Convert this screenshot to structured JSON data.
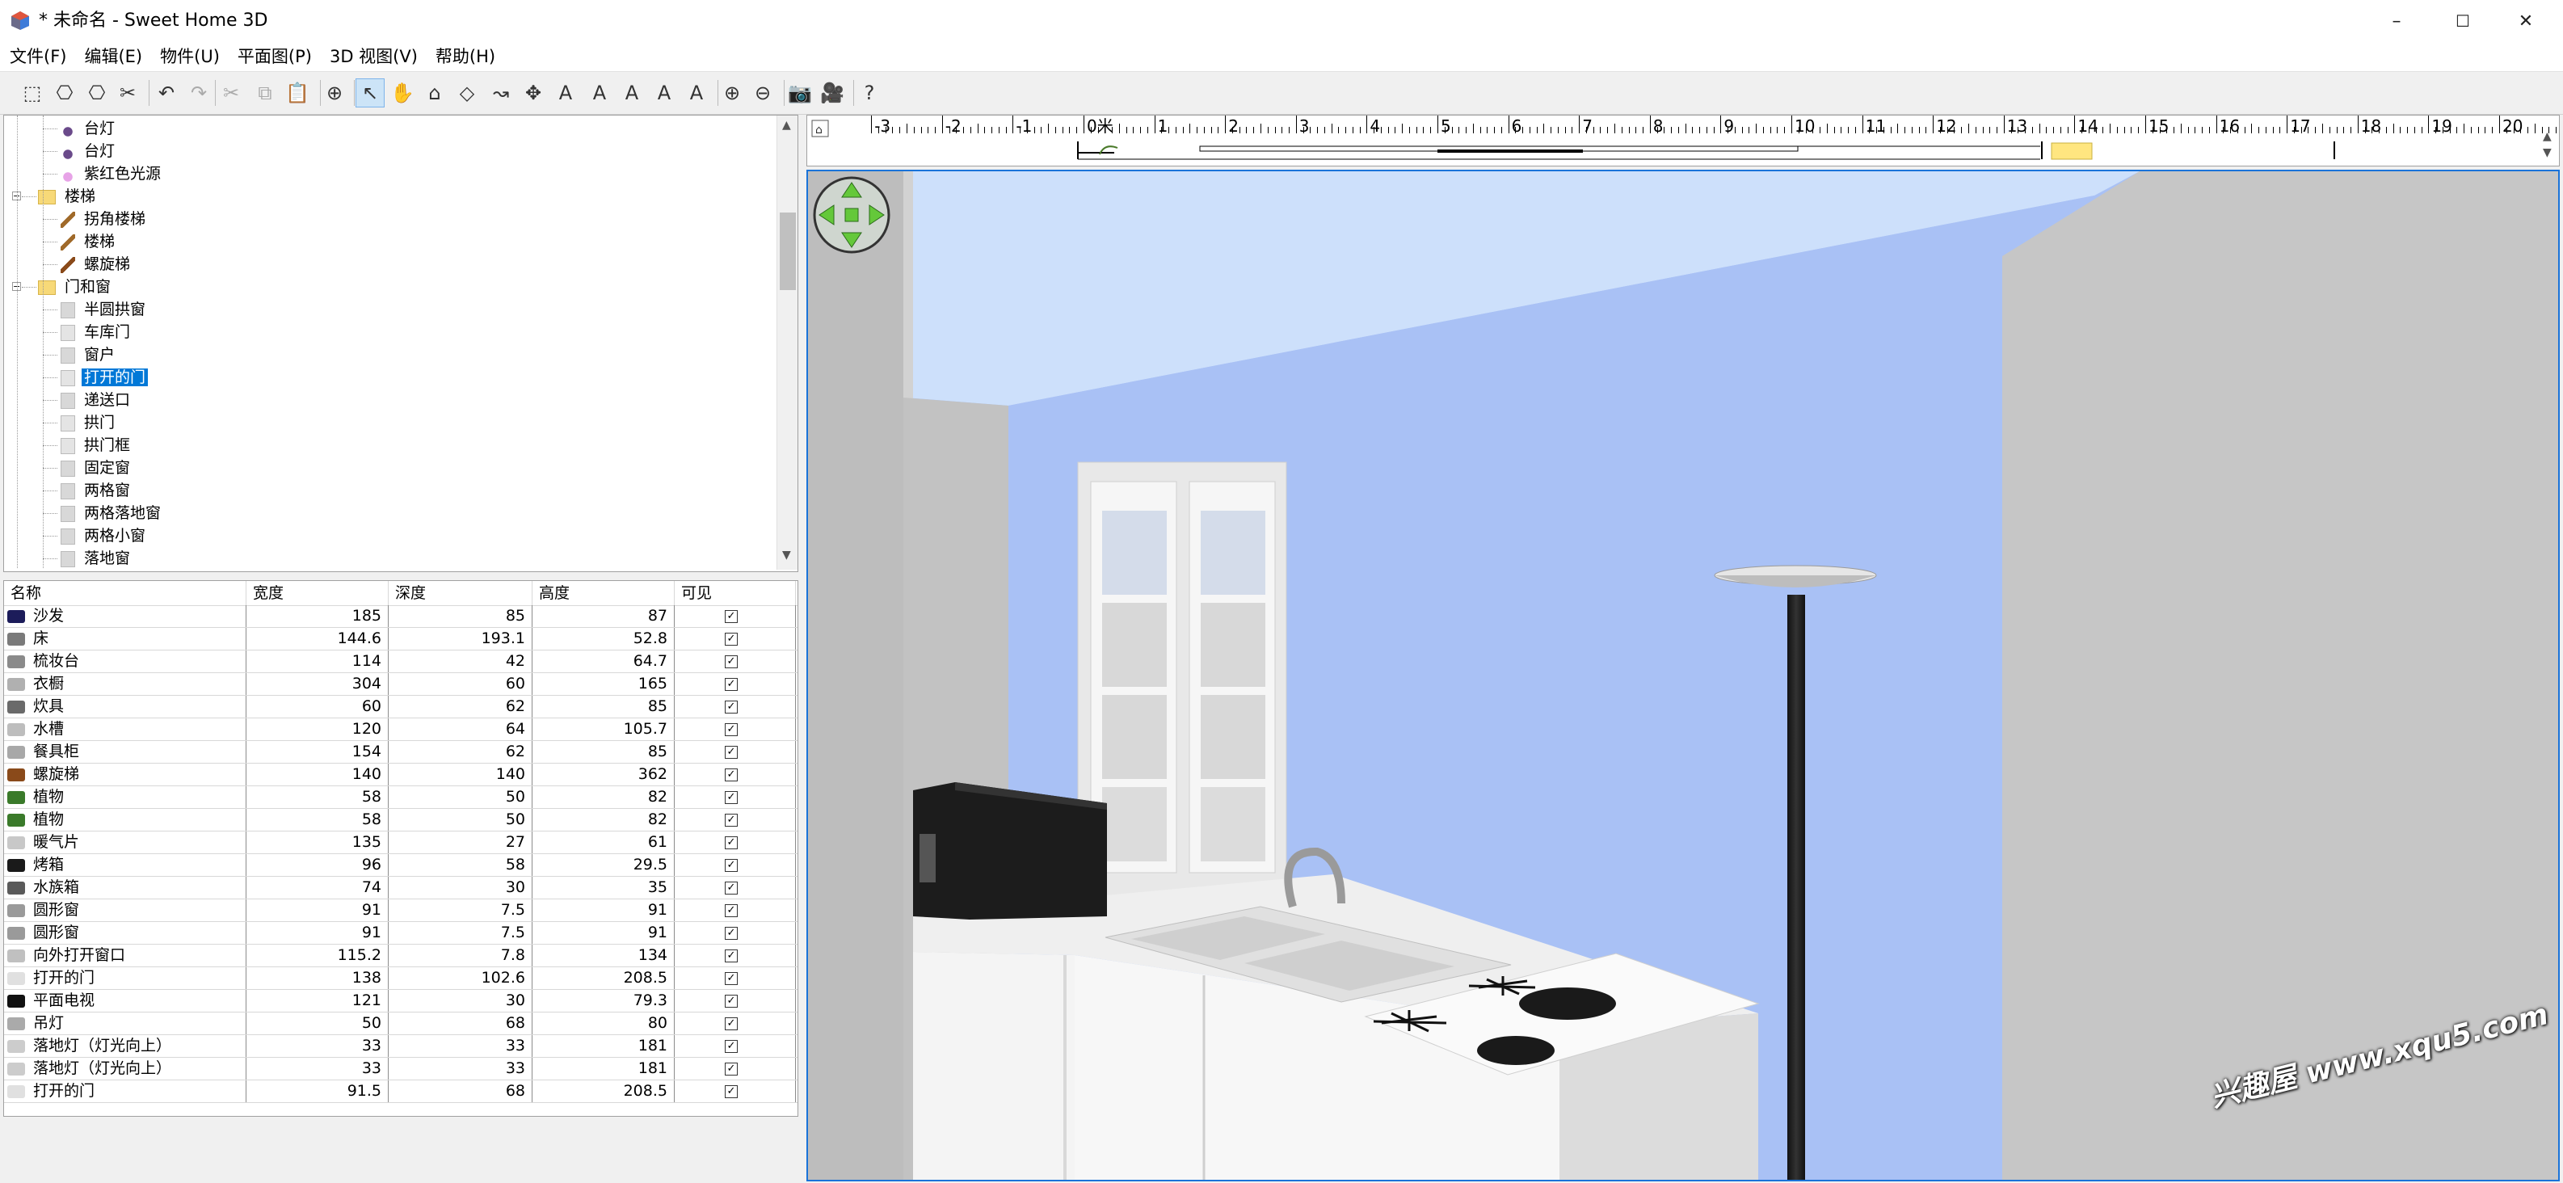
{
  "window": {
    "title": "* 未命名 - Sweet Home 3D",
    "minimize": "–",
    "maximize": "☐",
    "close": "✕"
  },
  "menu": [
    "文件(F)",
    "编辑(E)",
    "物件(U)",
    "平面图(P)",
    "3D 视图(V)",
    "帮助(H)"
  ],
  "toolbar": {
    "icons": [
      "new-home-icon",
      "open-icon",
      "save-icon",
      "cut-tool-icon",
      "undo-icon",
      "redo-icon",
      "cut-icon",
      "copy-icon",
      "paste-icon",
      "add-furniture-icon",
      "select-icon",
      "pan-icon",
      "create-walls-icon",
      "create-rooms-icon",
      "create-polylines-icon",
      "create-dimensions-icon",
      "add-text-icon",
      "increase-text-icon",
      "decrease-text-icon",
      "bold-icon",
      "italic-icon",
      "zoom-in-icon",
      "zoom-out-icon",
      "photo-icon",
      "video-icon",
      "help-icon"
    ],
    "glyphs": [
      "⬚",
      "⎔",
      "⎔",
      "✂",
      "↶",
      "↷",
      "✂",
      "⧉",
      "📋",
      "⊕",
      "↖",
      "✋",
      "⌂",
      "◇",
      "↝",
      "✥",
      "A",
      "A",
      "A",
      "A",
      "A",
      "⊕",
      "⊖",
      "📷",
      "🎥",
      "?"
    ],
    "selected": "select-icon"
  },
  "tree": {
    "items": [
      {
        "label": "台灯",
        "level": 2,
        "icon": "lamp-icon"
      },
      {
        "label": "台灯",
        "level": 2,
        "icon": "lamp-icon"
      },
      {
        "label": "紫红色光源",
        "level": 2,
        "icon": "light-source-icon"
      },
      {
        "label": "楼梯",
        "level": 1,
        "icon": "folder-icon",
        "expanded": true
      },
      {
        "label": "拐角楼梯",
        "level": 2,
        "icon": "stair-icon"
      },
      {
        "label": "楼梯",
        "level": 2,
        "icon": "stair-icon"
      },
      {
        "label": "螺旋梯",
        "level": 2,
        "icon": "spiral-stair-icon"
      },
      {
        "label": "门和窗",
        "level": 1,
        "icon": "folder-icon",
        "expanded": true
      },
      {
        "label": "半圆拱窗",
        "level": 2,
        "icon": "window-icon"
      },
      {
        "label": "车库门",
        "level": 2,
        "icon": "door-icon"
      },
      {
        "label": "窗户",
        "level": 2,
        "icon": "window-icon"
      },
      {
        "label": "打开的门",
        "level": 2,
        "icon": "door-icon",
        "selected": true
      },
      {
        "label": "递送口",
        "level": 2,
        "icon": "window-icon"
      },
      {
        "label": "拱门",
        "level": 2,
        "icon": "door-icon"
      },
      {
        "label": "拱门框",
        "level": 2,
        "icon": "door-icon"
      },
      {
        "label": "固定窗",
        "level": 2,
        "icon": "window-icon"
      },
      {
        "label": "两格窗",
        "level": 2,
        "icon": "window-icon"
      },
      {
        "label": "两格落地窗",
        "level": 2,
        "icon": "window-icon"
      },
      {
        "label": "两格小窗",
        "level": 2,
        "icon": "window-icon"
      },
      {
        "label": "落地窗",
        "level": 2,
        "icon": "window-icon"
      }
    ]
  },
  "furniture_table": {
    "columns": [
      "名称",
      "宽度",
      "深度",
      "高度",
      "可见"
    ],
    "rows": [
      {
        "name": "沙发",
        "width": "185",
        "depth": "85",
        "height": "87",
        "visible": true
      },
      {
        "name": "床",
        "width": "144.6",
        "depth": "193.1",
        "height": "52.8",
        "visible": true
      },
      {
        "name": "梳妆台",
        "width": "114",
        "depth": "42",
        "height": "64.7",
        "visible": true
      },
      {
        "name": "衣橱",
        "width": "304",
        "depth": "60",
        "height": "165",
        "visible": true
      },
      {
        "name": "炊具",
        "width": "60",
        "depth": "62",
        "height": "85",
        "visible": true
      },
      {
        "name": "水槽",
        "width": "120",
        "depth": "64",
        "height": "105.7",
        "visible": true
      },
      {
        "name": "餐具柜",
        "width": "154",
        "depth": "62",
        "height": "85",
        "visible": true
      },
      {
        "name": "螺旋梯",
        "width": "140",
        "depth": "140",
        "height": "362",
        "visible": true
      },
      {
        "name": "植物",
        "width": "58",
        "depth": "50",
        "height": "82",
        "visible": true
      },
      {
        "name": "植物",
        "width": "58",
        "depth": "50",
        "height": "82",
        "visible": true
      },
      {
        "name": "暖气片",
        "width": "135",
        "depth": "27",
        "height": "61",
        "visible": true
      },
      {
        "name": "烤箱",
        "width": "96",
        "depth": "58",
        "height": "29.5",
        "visible": true
      },
      {
        "name": "水族箱",
        "width": "74",
        "depth": "30",
        "height": "35",
        "visible": true
      },
      {
        "name": "圆形窗",
        "width": "91",
        "depth": "7.5",
        "height": "91",
        "visible": true
      },
      {
        "name": "圆形窗",
        "width": "91",
        "depth": "7.5",
        "height": "91",
        "visible": true
      },
      {
        "name": "向外打开窗口",
        "width": "115.2",
        "depth": "7.8",
        "height": "134",
        "visible": true
      },
      {
        "name": "打开的门",
        "width": "138",
        "depth": "102.6",
        "height": "208.5",
        "visible": true
      },
      {
        "name": "平面电视",
        "width": "121",
        "depth": "30",
        "height": "79.3",
        "visible": true
      },
      {
        "name": "吊灯",
        "width": "50",
        "depth": "68",
        "height": "80",
        "visible": true
      },
      {
        "name": "落地灯（灯光向上）",
        "width": "33",
        "depth": "33",
        "height": "181",
        "visible": true
      },
      {
        "name": "落地灯（灯光向上）",
        "width": "33",
        "depth": "33",
        "height": "181",
        "visible": true
      },
      {
        "name": "打开的门",
        "width": "91.5",
        "depth": "68",
        "height": "208.5",
        "visible": true
      }
    ]
  },
  "ruler": {
    "labels": [
      "-3",
      "-2",
      "-1",
      "0米",
      "1",
      "2",
      "3",
      "4",
      "5",
      "6",
      "7",
      "8",
      "9",
      "10",
      "11",
      "12",
      "13",
      "14",
      "15",
      "16",
      "17",
      "18",
      "19",
      "20"
    ],
    "values": [
      -3,
      -2,
      -1,
      0,
      1,
      2,
      3,
      4,
      5,
      6,
      7,
      8,
      9,
      10,
      11,
      12,
      13,
      14,
      15,
      16,
      17,
      18,
      19,
      20
    ]
  },
  "view3d": {
    "colors": {
      "sky": "#cde0fb",
      "wall": "#a9c1f5",
      "gray_wall": "#c6c6c6",
      "counter": "#f2f2f2"
    }
  },
  "watermark": "兴趣屋 www.xqu5.com"
}
